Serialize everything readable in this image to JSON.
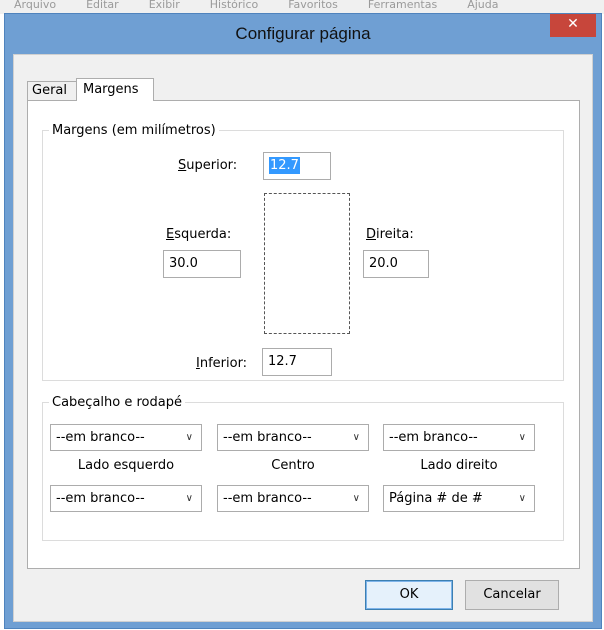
{
  "background_menu": [
    "Arquivo",
    "Editar",
    "Exibir",
    "Histórico",
    "Favoritos",
    "Ferramentas",
    "Ajuda"
  ],
  "window": {
    "title": "Configurar página",
    "close_glyph": "✕"
  },
  "tabs": [
    {
      "label": "Geral",
      "active": false
    },
    {
      "label": "Margens",
      "active": true
    }
  ],
  "margins": {
    "group_label": "Margens (em milímetros)",
    "top": {
      "accel": "S",
      "rest": "uperior:",
      "value": "12.7",
      "selected": true
    },
    "left": {
      "accel": "E",
      "rest": "squerda:",
      "value": "30.0"
    },
    "right": {
      "accel": "D",
      "rest": "ireita:",
      "value": "20.0"
    },
    "bottom": {
      "accel": "I",
      "rest": "nferior:",
      "value": "12.7"
    }
  },
  "header_footer": {
    "group_label": "Cabeçalho e rodapé",
    "column_labels": [
      "Lado esquerdo",
      "Centro",
      "Lado direito"
    ],
    "header_selects": [
      "--em branco--",
      "--em branco--",
      "--em branco--"
    ],
    "footer_selects": [
      "--em branco--",
      "--em branco--",
      "Página # de #"
    ]
  },
  "buttons": {
    "ok": "OK",
    "cancel": "Cancelar"
  },
  "colors": {
    "titlebar": "#6f9fd3",
    "close": "#c7463b",
    "selection": "#3399ff"
  }
}
